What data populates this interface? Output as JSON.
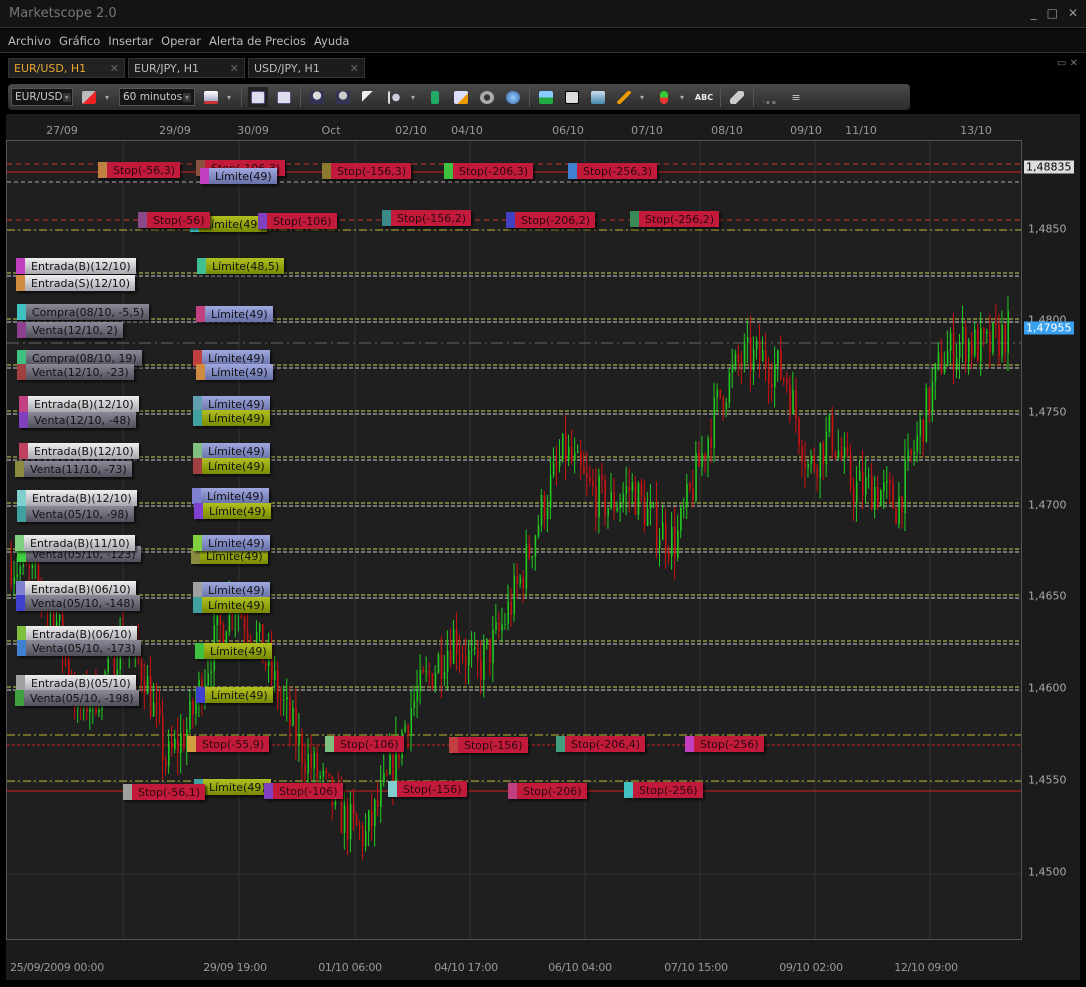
{
  "window": {
    "title": "Marketscope 2.0",
    "controls": [
      "_",
      "□",
      "✕"
    ]
  },
  "menu": [
    "Archivo",
    "Gráfico",
    "Insertar",
    "Operar",
    "Alerta de Precios",
    "Ayuda"
  ],
  "tabs": [
    {
      "label": "EUR/USD, H1",
      "active": true
    },
    {
      "label": "EUR/JPY, H1"
    },
    {
      "label": "USD/JPY, H1"
    }
  ],
  "toolbar": {
    "symbol": "EUR/USD",
    "timeframe": "60 minutos"
  },
  "axis": {
    "top_dates": [
      "27/09",
      "29/09",
      "30/09",
      "Oct",
      "02/10",
      "04/10",
      "06/10",
      "07/10",
      "08/10",
      "09/10",
      "11/10",
      "13/10"
    ],
    "bottom_dates": [
      "25/09/2009 00:00",
      "29/09 19:00",
      "01/10 06:00",
      "04/10 17:00",
      "06/10 04:00",
      "07/10 15:00",
      "09/10 02:00",
      "12/10 09:00"
    ],
    "price_ticks": [
      "1,4850",
      "1,4800",
      "1,4750",
      "1,4700",
      "1,4650",
      "1,4600",
      "1,4550",
      "1,4500"
    ],
    "high_marker": "1,48835",
    "current_price": "1,47955"
  },
  "chart_data": {
    "type": "candlestick",
    "symbol": "EUR/USD",
    "timeframe": "H1",
    "ylim": [
      1.4445,
      1.49
    ],
    "price_path": [
      1.467,
      1.466,
      1.464,
      1.459,
      1.46,
      1.463,
      1.461,
      1.456,
      1.458,
      1.462,
      1.465,
      1.463,
      1.46,
      1.457,
      1.455,
      1.453,
      1.452,
      1.455,
      1.459,
      1.461,
      1.463,
      1.461,
      1.463,
      1.466,
      1.47,
      1.473,
      1.471,
      1.47,
      1.471,
      1.469,
      1.468,
      1.472,
      1.476,
      1.478,
      1.478,
      1.477,
      1.472,
      1.474,
      1.471,
      1.471,
      1.47,
      1.474,
      1.478,
      1.479,
      1.4785,
      1.4795
    ],
    "colors": {
      "up": "#22cc22",
      "down": "#cc1111"
    }
  },
  "orders": [
    {
      "text": "Stop(-56,3)",
      "kind": "stop",
      "chip": "#c08040"
    },
    {
      "text": "Stop(-106,3)",
      "kind": "stop",
      "chip": "#8a5040"
    },
    {
      "text": "Límite(49)",
      "kind": "limb",
      "chip": "#c040c0"
    },
    {
      "text": "Stop(-156,3)",
      "kind": "stop",
      "chip": "#8a7a30"
    },
    {
      "text": "Stop(-206,3)",
      "kind": "stop",
      "chip": "#40c040"
    },
    {
      "text": "Stop(-256,3)",
      "kind": "stop",
      "chip": "#4080d0"
    },
    {
      "text": "Límite(49)",
      "kind": "limg",
      "chip": "#40c0c0"
    },
    {
      "text": "Stop(-56)",
      "kind": "stop",
      "chip": "#8a4a8a"
    },
    {
      "text": "Stop(-106)",
      "kind": "stop",
      "chip": "#8040c0"
    },
    {
      "text": "Stop(-156,2)",
      "kind": "stop",
      "chip": "#3a8a8a"
    },
    {
      "text": "Stop(-206,2)",
      "kind": "stop",
      "chip": "#4040c0"
    },
    {
      "text": "Stop(-256,2)",
      "kind": "stop",
      "chip": "#3a8a5a"
    },
    {
      "text": "Entrada(B)(12/10)",
      "kind": "ent",
      "chip": "#c040c0"
    },
    {
      "text": "Entrada(S)(12/10)",
      "kind": "ent",
      "chip": "#d08a40"
    },
    {
      "text": "Límite(48,5)",
      "kind": "limg",
      "chip": "#40c090"
    },
    {
      "text": "Compra(08/10, -5,5)",
      "kind": "pos",
      "chip": "#40c0c0"
    },
    {
      "text": "Venta(12/10, 2)",
      "kind": "pos",
      "chip": "#904090"
    },
    {
      "text": "Límite(49)",
      "kind": "limb",
      "chip": "#c04080"
    },
    {
      "text": "Compra(08/10, 19)",
      "kind": "pos",
      "chip": "#40c080"
    },
    {
      "text": "Venta(12/10, -23)",
      "kind": "pos",
      "chip": "#a04040"
    },
    {
      "text": "Límite(49)",
      "kind": "limb",
      "chip": "#c04040"
    },
    {
      "text": "Límite(49)",
      "kind": "limb",
      "chip": "#d08a40"
    },
    {
      "text": "Entrada(B)(12/10)",
      "kind": "ent",
      "chip": "#c04080"
    },
    {
      "text": "Venta(12/10, -48)",
      "kind": "pos",
      "chip": "#8040c0"
    },
    {
      "text": "Límite(49)",
      "kind": "limb",
      "chip": "#60a0b0"
    },
    {
      "text": "Límite(49)",
      "kind": "limg",
      "chip": "#40a0a0"
    },
    {
      "text": "Entrada(B)(12/10)",
      "kind": "ent",
      "chip": "#c04060"
    },
    {
      "text": "Venta(11/10, -73)",
      "kind": "pos",
      "chip": "#8a8a40"
    },
    {
      "text": "Límite(49)",
      "kind": "limb",
      "chip": "#80c080"
    },
    {
      "text": "Límite(49)",
      "kind": "limg",
      "chip": "#a04040"
    },
    {
      "text": "Entrada(B)(12/10)",
      "kind": "ent",
      "chip": "#80d0d0"
    },
    {
      "text": "Venta(05/10, -98)",
      "kind": "pos",
      "chip": "#40a0a0"
    },
    {
      "text": "Límite(49)",
      "kind": "limb",
      "chip": "#8080d0"
    },
    {
      "text": "Límite(49)",
      "kind": "limg",
      "chip": "#8040d0"
    },
    {
      "text": "Venta(05/10, -123)",
      "kind": "pos",
      "chip": "#40d040"
    },
    {
      "text": "Entrada(B)(11/10)",
      "kind": "ent",
      "chip": "#80d080"
    },
    {
      "text": "Límite(49)",
      "kind": "limg",
      "chip": "#8a8a40"
    },
    {
      "text": "Límite(49)",
      "kind": "limb",
      "chip": "#80d040"
    },
    {
      "text": "Entrada(B)(06/10)",
      "kind": "ent",
      "chip": "#8080d0"
    },
    {
      "text": "Venta(05/10, -148)",
      "kind": "pos",
      "chip": "#4040d0"
    },
    {
      "text": "Límite(49)",
      "kind": "limb",
      "chip": "#a0a0a0"
    },
    {
      "text": "Límite(49)",
      "kind": "limg",
      "chip": "#40a0a0"
    },
    {
      "text": "Entrada(B)(06/10)",
      "kind": "ent",
      "chip": "#80c040"
    },
    {
      "text": "Venta(05/10, -173)",
      "kind": "pos",
      "chip": "#4080d0"
    },
    {
      "text": "Límite(49)",
      "kind": "limg",
      "chip": "#40c040"
    },
    {
      "text": "Entrada(B)(05/10)",
      "kind": "ent",
      "chip": "#a0a0a0"
    },
    {
      "text": "Venta(05/10, -198)",
      "kind": "pos",
      "chip": "#40a040"
    },
    {
      "text": "Límite(49)",
      "kind": "limg",
      "chip": "#4040d0"
    },
    {
      "text": "Stop(-55,9)",
      "kind": "stop",
      "chip": "#d0a040"
    },
    {
      "text": "Stop(-106)",
      "kind": "stop",
      "chip": "#80c080"
    },
    {
      "text": "Stop(-156)",
      "kind": "stop",
      "chip": "#c04040"
    },
    {
      "text": "Stop(-206,4)",
      "kind": "stop",
      "chip": "#40a080"
    },
    {
      "text": "Stop(-256)",
      "kind": "stop",
      "chip": "#c040c0"
    },
    {
      "text": "Límite(49)",
      "kind": "limg",
      "chip": "#40a0a0"
    },
    {
      "text": "Stop(-56,1)",
      "kind": "stop",
      "chip": "#a0a0a0"
    },
    {
      "text": "Stop(-106)",
      "kind": "stop",
      "chip": "#8040c0"
    },
    {
      "text": "Stop(-156)",
      "kind": "stop",
      "chip": "#80d0d0"
    },
    {
      "text": "Stop(-206)",
      "kind": "stop",
      "chip": "#c04080"
    },
    {
      "text": "Stop(-256)",
      "kind": "stop",
      "chip": "#40c0c0"
    }
  ]
}
